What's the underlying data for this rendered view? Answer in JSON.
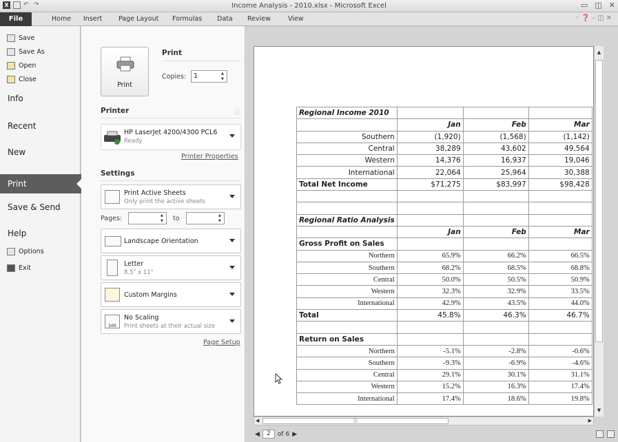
{
  "window": {
    "title": "Income Analysis - 2010.xlsx - Microsoft Excel",
    "app_icon": "X"
  },
  "ribbon": {
    "tabs": [
      {
        "label": "File"
      },
      {
        "label": "Home"
      },
      {
        "label": "Insert"
      },
      {
        "label": "Page Layout"
      },
      {
        "label": "Formulas"
      },
      {
        "label": "Data"
      },
      {
        "label": "Review"
      },
      {
        "label": "View"
      }
    ]
  },
  "backstage": {
    "commands": [
      {
        "label": "Save"
      },
      {
        "label": "Save As"
      },
      {
        "label": "Open"
      },
      {
        "label": "Close"
      }
    ],
    "nav": {
      "info": "Info",
      "recent": "Recent",
      "new": "New",
      "print": "Print",
      "save_send": "Save & Send",
      "help": "Help",
      "options": "Options",
      "exit": "Exit"
    }
  },
  "print_panel": {
    "heading": "Print",
    "print_button": "Print",
    "copies_label": "Copies:",
    "copies_value": "1",
    "printer_heading": "Printer",
    "printer_name": "HP LaserJet 4200/4300 PCL6",
    "printer_status": "Ready",
    "printer_properties": "Printer Properties",
    "settings_heading": "Settings",
    "active_sheets": "Print Active Sheets",
    "active_sheets_sub": "Only print the active sheets",
    "pages_label": "Pages:",
    "to_label": "to",
    "orientation": "Landscape Orientation",
    "paper": "Letter",
    "paper_sub": "8.5\" x 11\"",
    "margins": "Custom Margins",
    "scaling": "No Scaling",
    "scaling_sub": "Print sheets at their actual size",
    "scaling_icon_text": "100",
    "page_setup": "Page Setup"
  },
  "preview": {
    "current_page": "2",
    "page_count": "of 6",
    "table": {
      "income_title": "Regional Income 2010",
      "months": [
        "Jan",
        "Feb",
        "Mar"
      ],
      "income_rows": [
        {
          "label": "Southern",
          "values": [
            "(1,920)",
            "(1,568)",
            "(1,142)"
          ]
        },
        {
          "label": "Central",
          "values": [
            "38,289",
            "43,602",
            "49,564"
          ]
        },
        {
          "label": "Western",
          "values": [
            "14,376",
            "16,937",
            "19,046"
          ]
        },
        {
          "label": "International",
          "values": [
            "22,064",
            "25,964",
            "30,388"
          ]
        }
      ],
      "total_net_income": {
        "label": "Total Net Income",
        "values": [
          "$71,275",
          "$83,997",
          "$98,428"
        ]
      },
      "ratio_title": "Regional Ratio Analysis",
      "gross_profit_title": "Gross Profit on Sales",
      "gross_profit_rows": [
        {
          "label": "Northern",
          "values": [
            "65.9%",
            "66.2%",
            "66.5%"
          ]
        },
        {
          "label": "Southern",
          "values": [
            "68.2%",
            "68.5%",
            "68.8%"
          ]
        },
        {
          "label": "Central",
          "values": [
            "50.0%",
            "50.5%",
            "50.9%"
          ]
        },
        {
          "label": "Western",
          "values": [
            "32.3%",
            "32.9%",
            "33.5%"
          ]
        },
        {
          "label": "International",
          "values": [
            "42.9%",
            "43.5%",
            "44.0%"
          ]
        }
      ],
      "gross_total": {
        "label": "Total",
        "values": [
          "45.8%",
          "46.3%",
          "46.7%"
        ]
      },
      "return_title": "Return on Sales",
      "return_rows": [
        {
          "label": "Northern",
          "values": [
            "-5.1%",
            "-2.8%",
            "-0.6%"
          ]
        },
        {
          "label": "Southern",
          "values": [
            "-9.3%",
            "-6.9%",
            "-4.6%"
          ]
        },
        {
          "label": "Central",
          "values": [
            "29.1%",
            "30.1%",
            "31.1%"
          ]
        },
        {
          "label": "Western",
          "values": [
            "15.2%",
            "16.3%",
            "17.4%"
          ]
        },
        {
          "label": "International",
          "values": [
            "17.4%",
            "18.6%",
            "19.8%"
          ]
        }
      ]
    }
  }
}
